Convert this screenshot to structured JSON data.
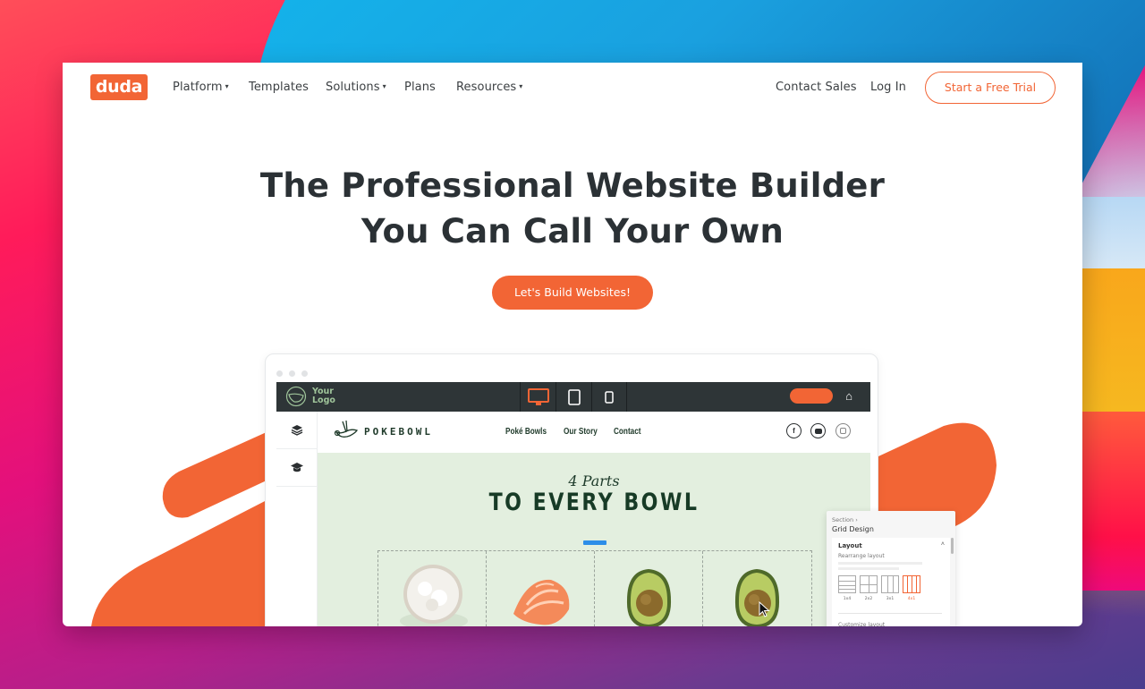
{
  "nav": {
    "logo": "duda",
    "items": [
      {
        "label": "Platform",
        "has_dropdown": true
      },
      {
        "label": "Templates",
        "has_dropdown": false
      },
      {
        "label": "Solutions",
        "has_dropdown": true
      },
      {
        "label": "Plans",
        "has_dropdown": false
      },
      {
        "label": "Resources",
        "has_dropdown": true
      }
    ],
    "contact_sales": "Contact Sales",
    "log_in": "Log In",
    "trial_button": "Start a Free Trial",
    "chevron": "⌄"
  },
  "hero": {
    "title_line1": "The Professional Website Builder",
    "title_line2": "You Can Call Your Own",
    "cta": "Let's Build Websites!"
  },
  "editor": {
    "logo_text": "Your Logo",
    "devices": [
      "desktop-icon",
      "tablet-icon",
      "mobile-icon"
    ],
    "active_device": "desktop",
    "rail_icons": [
      "layers-icon",
      "graduation-cap-icon"
    ],
    "site": {
      "brand": "POKEBOWL",
      "links": [
        "Poké Bowls",
        "Our Story",
        "Contact"
      ],
      "socials": [
        "facebook-icon",
        "youtube-icon",
        "instagram-icon"
      ],
      "eyebrow": "4 Parts",
      "headline": "TO EVERY BOWL",
      "items": [
        "rice",
        "salmon",
        "avocado",
        "avocado"
      ]
    },
    "panel": {
      "breadcrumb": "Section ›",
      "title": "Grid Design",
      "section": "Layout",
      "subtitle": "Rearrange layout",
      "options": [
        "1x4",
        "2x2",
        "3x1",
        "4x1"
      ],
      "selected_option": "4x1",
      "footer": "Customize layout"
    }
  },
  "colors": {
    "brand": "#f26535",
    "heading": "#2b3135",
    "editor_bar": "#2e3537",
    "site_bg": "#e3efdf",
    "site_green": "#173b26"
  }
}
